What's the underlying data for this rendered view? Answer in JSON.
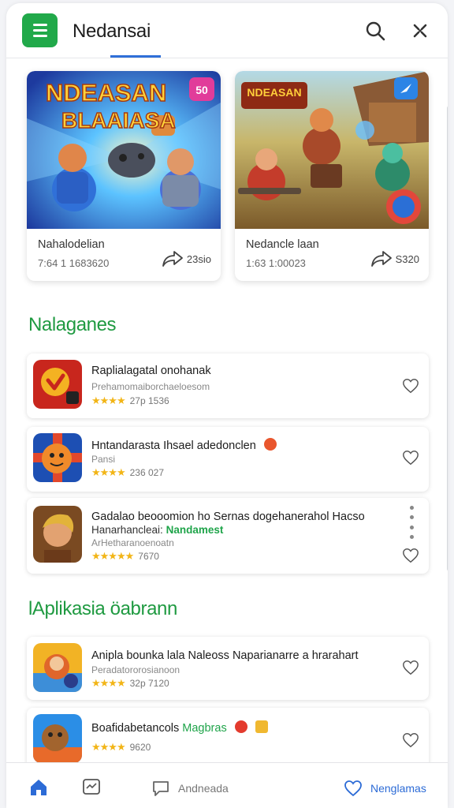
{
  "header": {
    "title": "Nedansai",
    "menu_icon": "hamburger-menu-icon",
    "search_icon": "search-icon",
    "close_icon": "close-icon",
    "accent": "#21a94a"
  },
  "featured": [
    {
      "banner_text": "NDEASAN",
      "banner_sub": "BLAAIASA",
      "title": "Nahalodelian",
      "meta": "7:64 1 1683620",
      "share_count": "23sio",
      "share_icon": "share-arrow-icon"
    },
    {
      "banner_text": "NDEASAN",
      "title": "Nedancle laan",
      "meta": "1:63 1:00023",
      "share_count": "S320",
      "share_icon": "share-arrow-icon"
    }
  ],
  "sections": [
    {
      "title": "Nalaganes",
      "items": [
        {
          "title": "Raplialagatal onohanak",
          "subtitle": "Prehamomaiborchaeloesom",
          "rating": "★★★★",
          "rating_meta": "27p 1536"
        },
        {
          "title": "Hntandarasta Ihsael adedonclen",
          "subtitle": "Pansi",
          "rating": "★★★★",
          "rating_meta": "236 027"
        },
        {
          "title": "Gadalao beooomion ho Sernas dogehanerahol Hacso",
          "subtitle_prefix": "Hanarhancleai:",
          "subtitle_highlight": "Nandamest",
          "subtitle2": "ArHetharanoenoatn",
          "rating": "★★★★★",
          "rating_meta": "7670"
        }
      ]
    },
    {
      "title": "lAplikasia öabrann",
      "items": [
        {
          "title": "Anipla bounka lala  Naleoss Naparianarre a hrarahart",
          "subtitle": "Peradatororosianoon",
          "rating": "★★★★",
          "rating_meta": "32p 7120"
        },
        {
          "title": "Boafidabetancols",
          "title_highlight": "Magbras",
          "rating": "★★★★",
          "rating_meta": "9620"
        }
      ]
    }
  ],
  "bottom_nav": {
    "home_icon": "home-icon",
    "activity_icon": "activity-icon",
    "chat_label": "Andneada",
    "fav_label": "Nenglamas",
    "active_color": "#2c6bd6"
  }
}
